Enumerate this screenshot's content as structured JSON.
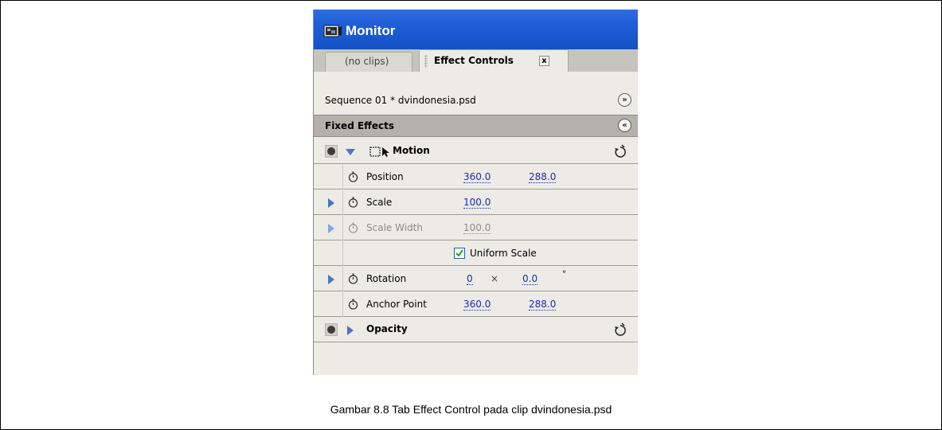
{
  "window": {
    "title": "Monitor",
    "tabs": [
      {
        "label": "(no clips)",
        "active": false
      },
      {
        "label": "Effect Controls",
        "active": true
      }
    ],
    "tab_close": "x"
  },
  "sequence": {
    "label": "Sequence 01 * dvindonesia.psd",
    "button": "»"
  },
  "fixed_effects": {
    "label": "Fixed Effects",
    "button": "«"
  },
  "motion": {
    "label": "Motion",
    "expanded": true,
    "properties": {
      "position": {
        "label": "Position",
        "x": "360.0",
        "y": "288.0"
      },
      "scale": {
        "label": "Scale",
        "value": "100.0"
      },
      "scale_width": {
        "label": "Scale Width",
        "value": "100.0",
        "disabled": true
      },
      "uniform_scale": {
        "label": "Uniform Scale",
        "checked": true
      },
      "rotation": {
        "label": "Rotation",
        "turns": "0",
        "times": "×",
        "degrees": "0.0",
        "unit": "°"
      },
      "anchor_point": {
        "label": "Anchor Point",
        "x": "360.0",
        "y": "288.0"
      }
    }
  },
  "opacity": {
    "label": "Opacity",
    "expanded": false
  },
  "caption": "Gambar 8.8 Tab Effect Control pada clip dvindonesia.psd",
  "colors": {
    "titlebar": "#1f5fd8",
    "panel_bg": "#ecebe6",
    "header_bg": "#b3b1a9",
    "value_link": "#1d2cb0",
    "triangle": "#4e74bd"
  }
}
